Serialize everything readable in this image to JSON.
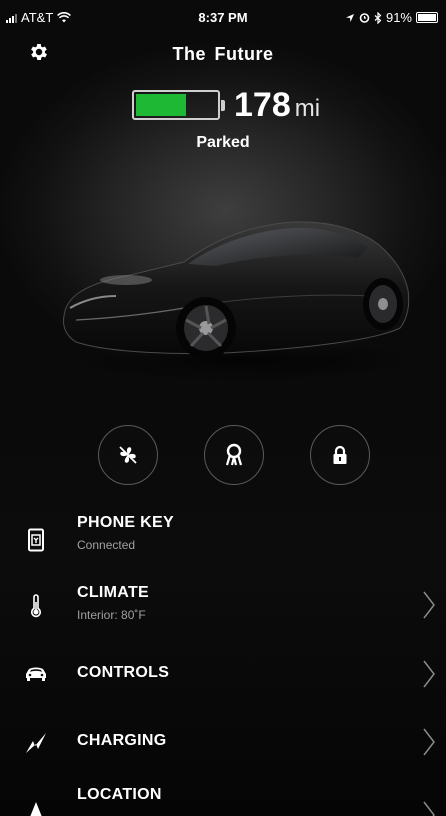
{
  "status_bar": {
    "carrier": "AT&T",
    "time": "8:37 PM",
    "battery_percent": "91%"
  },
  "header": {
    "settings_icon": "gear-icon",
    "car_name": "The  Future"
  },
  "range": {
    "battery_level": 0.62,
    "value": "178",
    "unit": "mi",
    "battery_fill_color": "#1eb834"
  },
  "vehicle_state": "Parked",
  "quick_actions": [
    {
      "icon": "fan-icon",
      "name": "climate-toggle"
    },
    {
      "icon": "key-icon",
      "name": "phone-key"
    },
    {
      "icon": "lock-icon",
      "name": "lock"
    }
  ],
  "menu": [
    {
      "icon": "phone-key-icon",
      "title": "PHONE KEY",
      "subtitle": "Connected",
      "chevron": false
    },
    {
      "icon": "thermometer-icon",
      "title": "CLIMATE",
      "subtitle": "Interior: 80˚F",
      "chevron": true
    },
    {
      "icon": "car-icon",
      "title": "CONTROLS",
      "subtitle": "",
      "chevron": true
    },
    {
      "icon": "lightning-icon",
      "title": "CHARGING",
      "subtitle": "",
      "chevron": true
    },
    {
      "icon": "location-icon",
      "title": "LOCATION",
      "subtitle": "",
      "chevron": true
    }
  ]
}
